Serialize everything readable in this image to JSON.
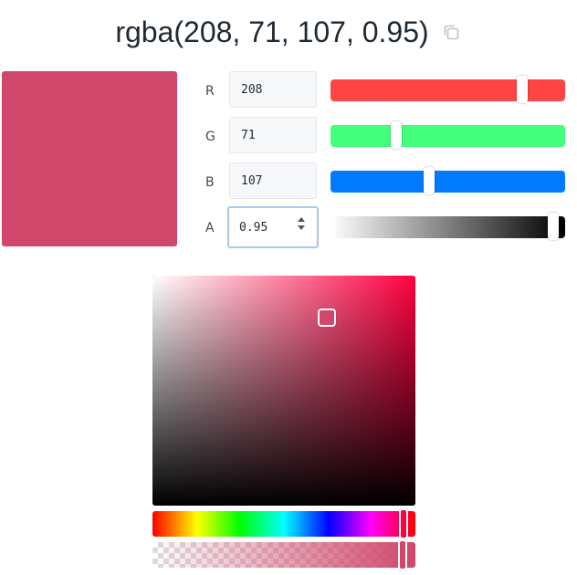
{
  "header": {
    "color_string": "rgba(208, 71, 107, 0.95)",
    "copy_icon": "copy-icon"
  },
  "color": {
    "hex": "#d0476b",
    "r": 208,
    "g": 71,
    "b": 107,
    "a": 0.95,
    "hue_hex": "#ff0040"
  },
  "channels": [
    {
      "label": "R",
      "value": "208",
      "track_color": "#ff4444",
      "fraction": 0.8157
    },
    {
      "label": "G",
      "value": "71",
      "track_color": "#44ff7c",
      "fraction": 0.2784
    },
    {
      "label": "B",
      "value": "107",
      "track_color": "#007bff",
      "fraction": 0.4196
    },
    {
      "label": "A",
      "value": "0.95",
      "track_color": "#000000",
      "fraction": 0.95
    }
  ],
  "picker": {
    "saturation": 0.66,
    "value": 0.82,
    "hue_fraction": 0.955,
    "alpha_fraction": 0.95
  }
}
